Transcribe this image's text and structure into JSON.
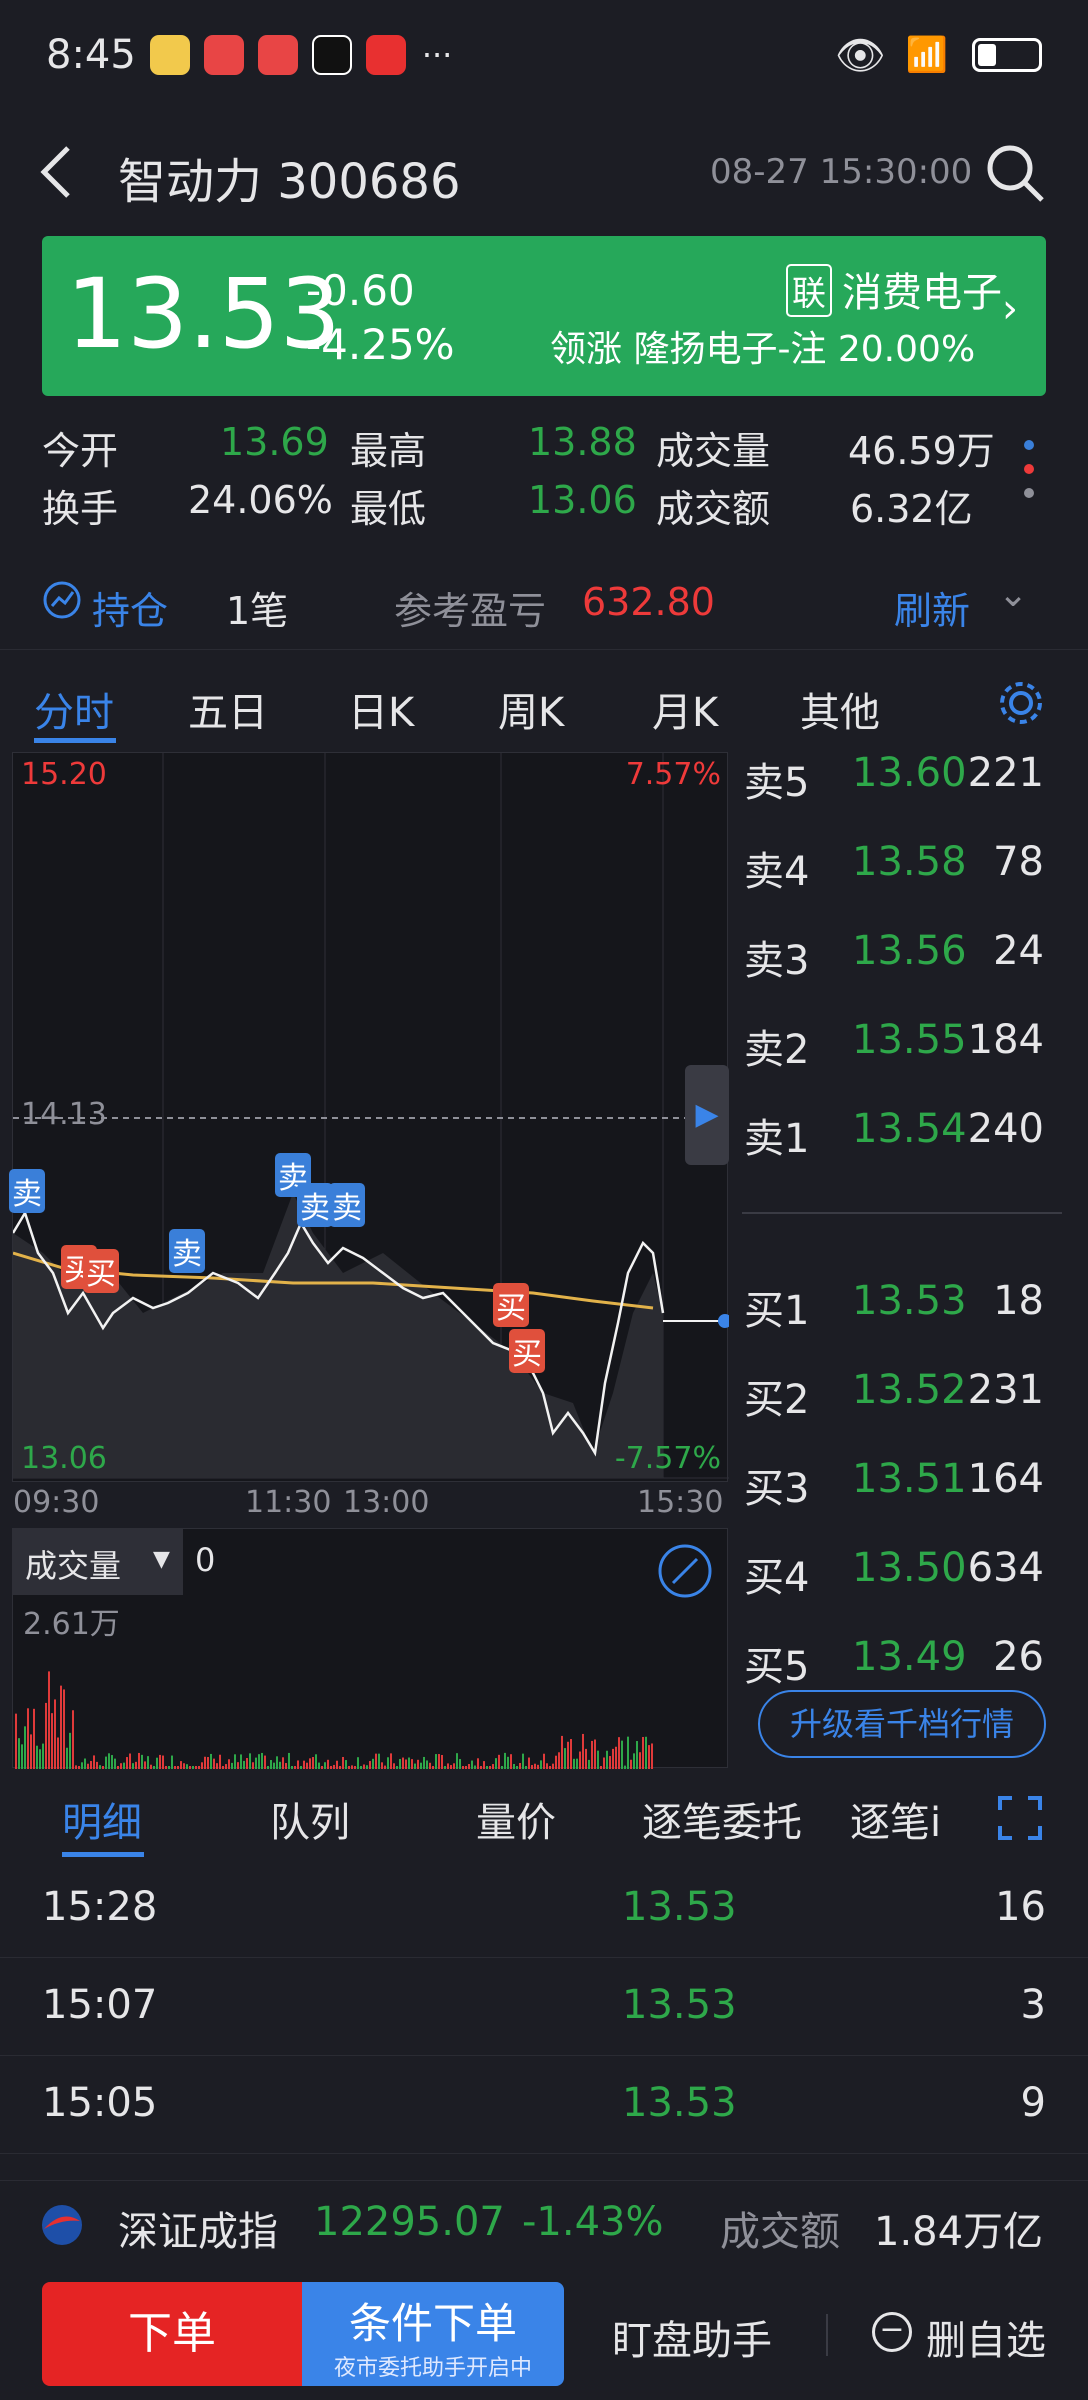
{
  "status": {
    "time": "8:45",
    "more": "···"
  },
  "header": {
    "title": "智动力 300686",
    "datetime": "08-27 15:30:00"
  },
  "quote": {
    "price": "13.53",
    "change": "-0.60",
    "change_pct": "-4.25%",
    "sector_badge": "联",
    "sector": "消费电子",
    "leader": "领涨  隆扬电子-注  20.00%"
  },
  "stats": {
    "open_label": "今开",
    "open": "13.69",
    "high_label": "最高",
    "high": "13.88",
    "vol_label": "成交量",
    "vol": "46.59万",
    "turn_label": "换手",
    "turn": "24.06%",
    "low_label": "最低",
    "low": "13.06",
    "amt_label": "成交额",
    "amt": "6.32亿"
  },
  "position": {
    "label": "持仓",
    "count": "1笔",
    "pnl_label": "参考盈亏",
    "pnl": "632.80",
    "refresh": "刷新"
  },
  "chart_tabs": [
    "分时",
    "五日",
    "日K",
    "周K",
    "月K",
    "其他"
  ],
  "chart_data": {
    "type": "line",
    "y_top": "15.20",
    "y_mid": "14.13",
    "y_bottom": "13.06",
    "pct_top": "7.57%",
    "pct_bottom": "-7.57%",
    "x_labels": [
      "09:30",
      "11:30",
      "13:00",
      "15:30"
    ],
    "trade_marks": [
      "卖",
      "买",
      "买",
      "卖",
      "卖",
      "卖",
      "卖",
      "买",
      "买"
    ]
  },
  "volume": {
    "label": "成交量",
    "value": "0",
    "max": "2.61万"
  },
  "orderbook": {
    "asks": [
      {
        "label": "卖5",
        "price": "13.60",
        "qty": "221"
      },
      {
        "label": "卖4",
        "price": "13.58",
        "qty": "78"
      },
      {
        "label": "卖3",
        "price": "13.56",
        "qty": "24"
      },
      {
        "label": "卖2",
        "price": "13.55",
        "qty": "184"
      },
      {
        "label": "卖1",
        "price": "13.54",
        "qty": "240"
      }
    ],
    "bids": [
      {
        "label": "买1",
        "price": "13.53",
        "qty": "18"
      },
      {
        "label": "买2",
        "price": "13.52",
        "qty": "231"
      },
      {
        "label": "买3",
        "price": "13.51",
        "qty": "164"
      },
      {
        "label": "买4",
        "price": "13.50",
        "qty": "634"
      },
      {
        "label": "买5",
        "price": "13.49",
        "qty": "26"
      }
    ],
    "upgrade": "升级看千档行情"
  },
  "detail_tabs": [
    "明细",
    "队列",
    "量价",
    "逐笔委托",
    "逐笔i"
  ],
  "trades": [
    {
      "time": "15:28",
      "price": "13.53",
      "qty": "16"
    },
    {
      "time": "15:07",
      "price": "13.53",
      "qty": "3"
    },
    {
      "time": "15:05",
      "price": "13.53",
      "qty": "9"
    }
  ],
  "index": {
    "name": "深证成指",
    "value": "12295.07",
    "change": "-1.43%",
    "amt_label": "成交额",
    "amt": "1.84万亿"
  },
  "bottom": {
    "order": "下单",
    "cond": "条件下单",
    "cond_sub": "夜市委托助手开启中",
    "watch": "盯盘助手",
    "remove": "删自选"
  }
}
